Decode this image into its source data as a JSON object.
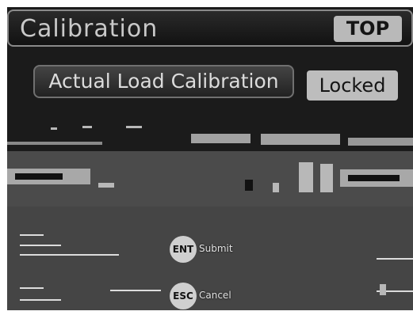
{
  "header": {
    "title": "Calibration",
    "top_button": "TOP"
  },
  "section": {
    "button_label": "Actual Load Calibration",
    "status_badge": "Locked"
  },
  "keys": [
    {
      "key": "ENT",
      "label": "Submit"
    },
    {
      "key": "ESC",
      "label": "Cancel"
    }
  ]
}
